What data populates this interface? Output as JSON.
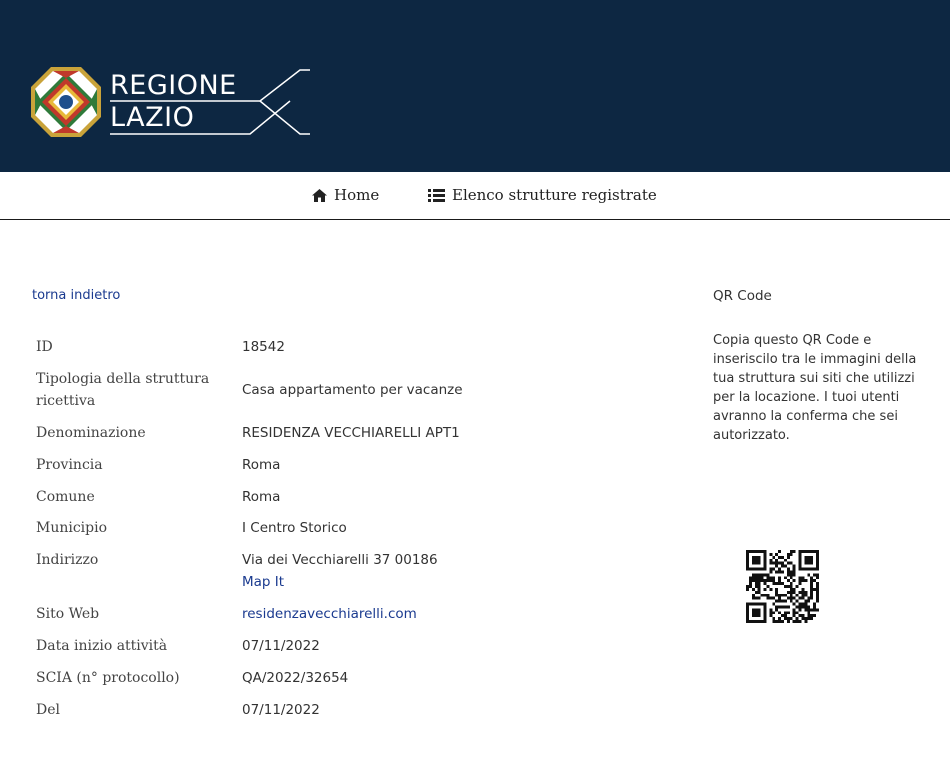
{
  "header": {
    "logo": {
      "line1": "REGIONE",
      "line2": "LAZIO",
      "emblem_icon": "regione-lazio-emblem-icon"
    },
    "background_color": "#0d2742"
  },
  "nav": {
    "items": [
      {
        "label": "Home",
        "icon": "home-icon"
      },
      {
        "label": "Elenco strutture registrate",
        "icon": "list-icon"
      }
    ]
  },
  "back_link": "torna indietro",
  "details": {
    "rows": [
      {
        "label": "ID",
        "value": "18542"
      },
      {
        "label": "Tipologia della struttura ricettiva",
        "value": "Casa appartamento per vacanze"
      },
      {
        "label": "Denominazione",
        "value": "RESIDENZA VECCHIARELLI APT1"
      },
      {
        "label": "Provincia",
        "value": "Roma"
      },
      {
        "label": "Comune",
        "value": "Roma"
      },
      {
        "label": "Municipio",
        "value": "I Centro Storico"
      },
      {
        "label": "Indirizzo",
        "value": "Via dei Vecchiarelli 37 00186",
        "link": "Map It"
      },
      {
        "label": "Sito Web",
        "link": "residenzavecchiarelli.com"
      },
      {
        "label": "Data inizio attività",
        "value": "07/11/2022"
      },
      {
        "label": "SCIA (n° protocollo)",
        "value": "QA/2022/32654"
      },
      {
        "label": "Del",
        "value": "07/11/2022"
      }
    ]
  },
  "qr": {
    "title": "QR Code",
    "description": "Copia questo QR Code e inseriscilo tra le immagini della tua struttura sui siti che utilizzi per la locazione. I tuoi utenti avranno la conferma che sei autorizzato.",
    "icon": "qr-code-icon"
  },
  "colors": {
    "link": "#1a3a8f",
    "header_bg": "#0d2742"
  }
}
